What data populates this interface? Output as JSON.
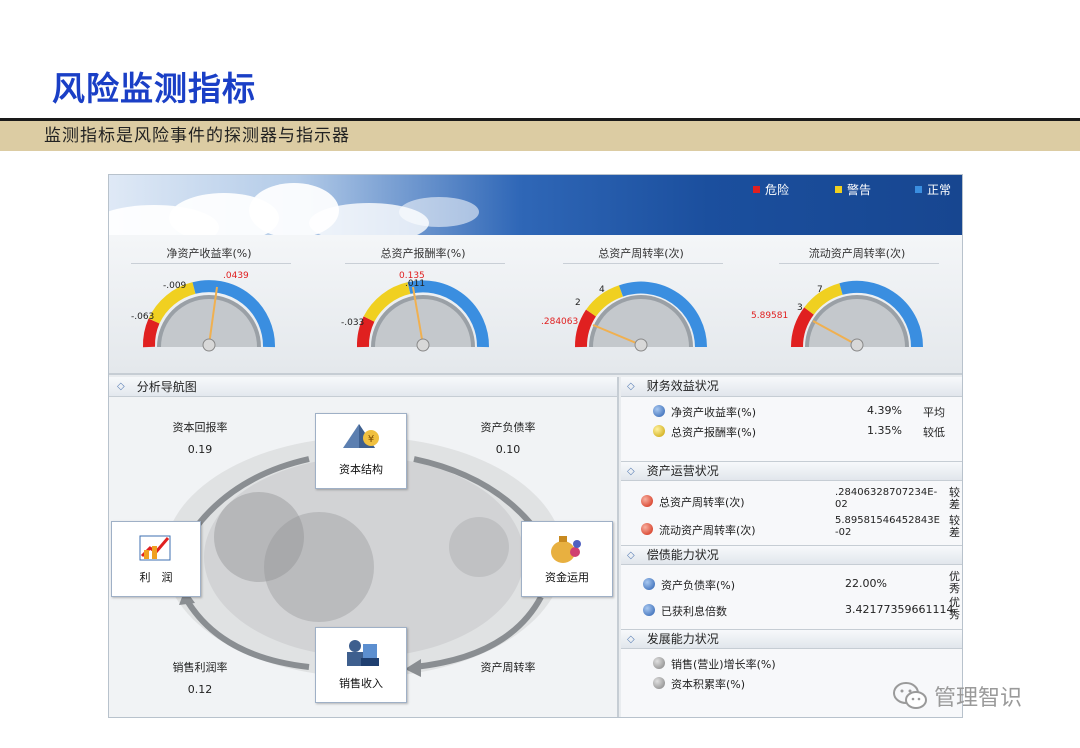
{
  "slide": {
    "title": "风险监测指标",
    "subtitle": "监测指标是风险事件的探测器与指示器"
  },
  "colors": {
    "danger": "#e02020",
    "warning": "#f0d020",
    "normal": "#3a8ee0",
    "title": "#1a3fc6",
    "band": "#dccca3"
  },
  "legend": [
    {
      "label": "危险",
      "color": "#e02020"
    },
    {
      "label": "警告",
      "color": "#f0d020"
    },
    {
      "label": "正常",
      "color": "#3a8ee0"
    }
  ],
  "gauges": [
    {
      "label": "净资产收益率(%)",
      "ticks": [
        "-.063",
        "-.009"
      ],
      "value_text": ".0439"
    },
    {
      "label": "总资产报酬率(%)",
      "ticks": [
        "-.033",
        ".011"
      ],
      "value_text": "0.135"
    },
    {
      "label": "总资产周转率(次)",
      "ticks": [
        "2",
        "4"
      ],
      "value_text": ".284063"
    },
    {
      "label": "流动资产周转率(次)",
      "ticks": [
        "3",
        "7"
      ],
      "value_text": "5.89581"
    }
  ],
  "analysis": {
    "title": "分析导航图",
    "nodes": {
      "capital_structure": "资本结构",
      "profit": "利　润",
      "fund_use": "资金运用",
      "sales_income": "销售收入"
    },
    "metrics": {
      "return_on_capital": {
        "label": "资本回报率",
        "value": "0.19"
      },
      "debt_ratio": {
        "label": "资产负债率",
        "value": "0.10"
      },
      "profit_margin": {
        "label": "销售利润率",
        "value": "0.12"
      },
      "asset_turnover": {
        "label": "资产周转率"
      }
    }
  },
  "sections": [
    {
      "title": "财务效益状况",
      "rows": [
        {
          "icon": "blue",
          "label": "净资产收益率(%)",
          "value": "4.39%",
          "rating": "平均"
        },
        {
          "icon": "yellow",
          "label": "总资产报酬率(%)",
          "value": "1.35%",
          "rating": "较低"
        }
      ]
    },
    {
      "title": "资产运营状况",
      "rows": [
        {
          "icon": "red",
          "label": "总资产周转率(次)",
          "value": ".28406328707234E-02",
          "rating": "较差"
        },
        {
          "icon": "red",
          "label": "流动资产周转率(次)",
          "value": "5.89581546452843E-02",
          "rating": "较差"
        }
      ]
    },
    {
      "title": "偿债能力状况",
      "rows": [
        {
          "icon": "blue",
          "label": "资产负债率(%)",
          "value": "22.00%",
          "rating": "优秀"
        },
        {
          "icon": "blue",
          "label": "已获利息倍数",
          "value": "3.42177359661114",
          "rating": "优秀"
        }
      ]
    },
    {
      "title": "发展能力状况",
      "rows": [
        {
          "icon": "gray",
          "label": "销售(营业)增长率(%)",
          "value": "",
          "rating": ""
        },
        {
          "icon": "gray",
          "label": "资本积累率(%)",
          "value": "",
          "rating": ""
        }
      ]
    }
  ],
  "watermark": "管理智识"
}
